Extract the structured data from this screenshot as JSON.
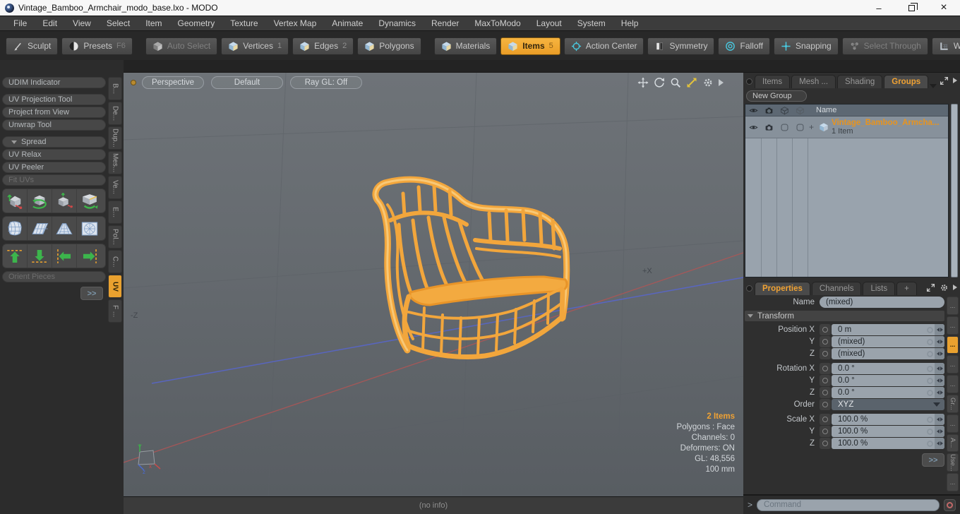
{
  "window": {
    "title": "Vintage_Bamboo_Armchair_modo_base.lxo - MODO"
  },
  "icons": {
    "minimize": "–",
    "close": "×",
    "dots": "...",
    "prompt": ">",
    "plus": "+",
    "more": ">>"
  },
  "menu": {
    "items": [
      "File",
      "Edit",
      "View",
      "Select",
      "Item",
      "Geometry",
      "Texture",
      "Vertex Map",
      "Animate",
      "Dynamics",
      "Render",
      "MaxToModo",
      "Layout",
      "System",
      "Help"
    ]
  },
  "toolbar": {
    "sculpt": "Sculpt",
    "presets": "Presets",
    "presets_key": "F6",
    "auto_select": "Auto Select",
    "vertices": "Vertices",
    "vertices_badge": "1",
    "edges": "Edges",
    "edges_badge": "2",
    "polygons": "Polygons",
    "materials": "Materials",
    "items": "Items",
    "items_badge": "5",
    "action_center": "Action Center",
    "symmetry": "Symmetry",
    "falloff": "Falloff",
    "snapping": "Snapping",
    "select_through": "Select Through",
    "workplane": "WorkPlane"
  },
  "sidebar": {
    "buttons": [
      "UDIM Indicator",
      "UV Projection Tool",
      "Project from View",
      "Unwrap Tool"
    ],
    "spread": "Spread",
    "spread_buttons": [
      "UV Relax",
      "UV Peeler",
      "Fit UVs"
    ],
    "orient_pieces": "Orient Pieces",
    "tabs": [
      "B...",
      "De...",
      "Dup...",
      "Mes...",
      "Ve...",
      "E...",
      "Pol...",
      "C...",
      "UV",
      "F ..."
    ],
    "active_tab": "UV"
  },
  "viewport": {
    "mode": "Perspective",
    "view": "Default",
    "raygl": "Ray GL: Off",
    "axis_x_label": "+X",
    "axis_z_label": "-Z",
    "gizmo": {
      "x": "x",
      "y": "Y",
      "z": "z"
    },
    "stats": [
      "2 Items",
      "Polygons : Face",
      "Channels: 0",
      "Deformers: ON",
      "GL: 48,556",
      "100 mm"
    ],
    "status": "(no info)"
  },
  "items_panel": {
    "tabs": [
      "Items",
      "Mesh ...",
      "Shading",
      "Groups"
    ],
    "active_tab": "Groups",
    "new_group": "New Group",
    "name_column": "Name",
    "row": {
      "expander": "+",
      "name": "Vintage_Bamboo_Armcha...",
      "sub": "1 Item"
    }
  },
  "properties_panel": {
    "tabs": [
      "Properties",
      "Channels",
      "Lists",
      "+"
    ],
    "active_tab": "Properties",
    "name_label": "Name",
    "name_value": "(mixed)",
    "section": "Transform",
    "rows": [
      {
        "label": "Position X",
        "value": "0 m"
      },
      {
        "label": "Y",
        "value": "(mixed)"
      },
      {
        "label": "Z",
        "value": "(mixed)"
      },
      {
        "label": "Rotation X",
        "value": "0.0 °"
      },
      {
        "label": "Y",
        "value": "0.0 °"
      },
      {
        "label": "Z",
        "value": "0.0 °"
      },
      {
        "label": "Order",
        "value": "XYZ"
      },
      {
        "label": "Scale X",
        "value": "100.0 %"
      },
      {
        "label": "Y",
        "value": "100.0 %"
      },
      {
        "label": "Z",
        "value": "100.0 %"
      }
    ],
    "strip": [
      "...",
      "...",
      "...",
      "...",
      "...",
      "Gr...",
      "...",
      "A...",
      "Use...",
      "..."
    ]
  },
  "command_bar": {
    "prompt": ">",
    "placeholder": "Command"
  },
  "colors": {
    "accent": "#f0a233",
    "wire": "#f2a63c",
    "axis_x": "#b25555",
    "axis_z": "#5866c9"
  }
}
